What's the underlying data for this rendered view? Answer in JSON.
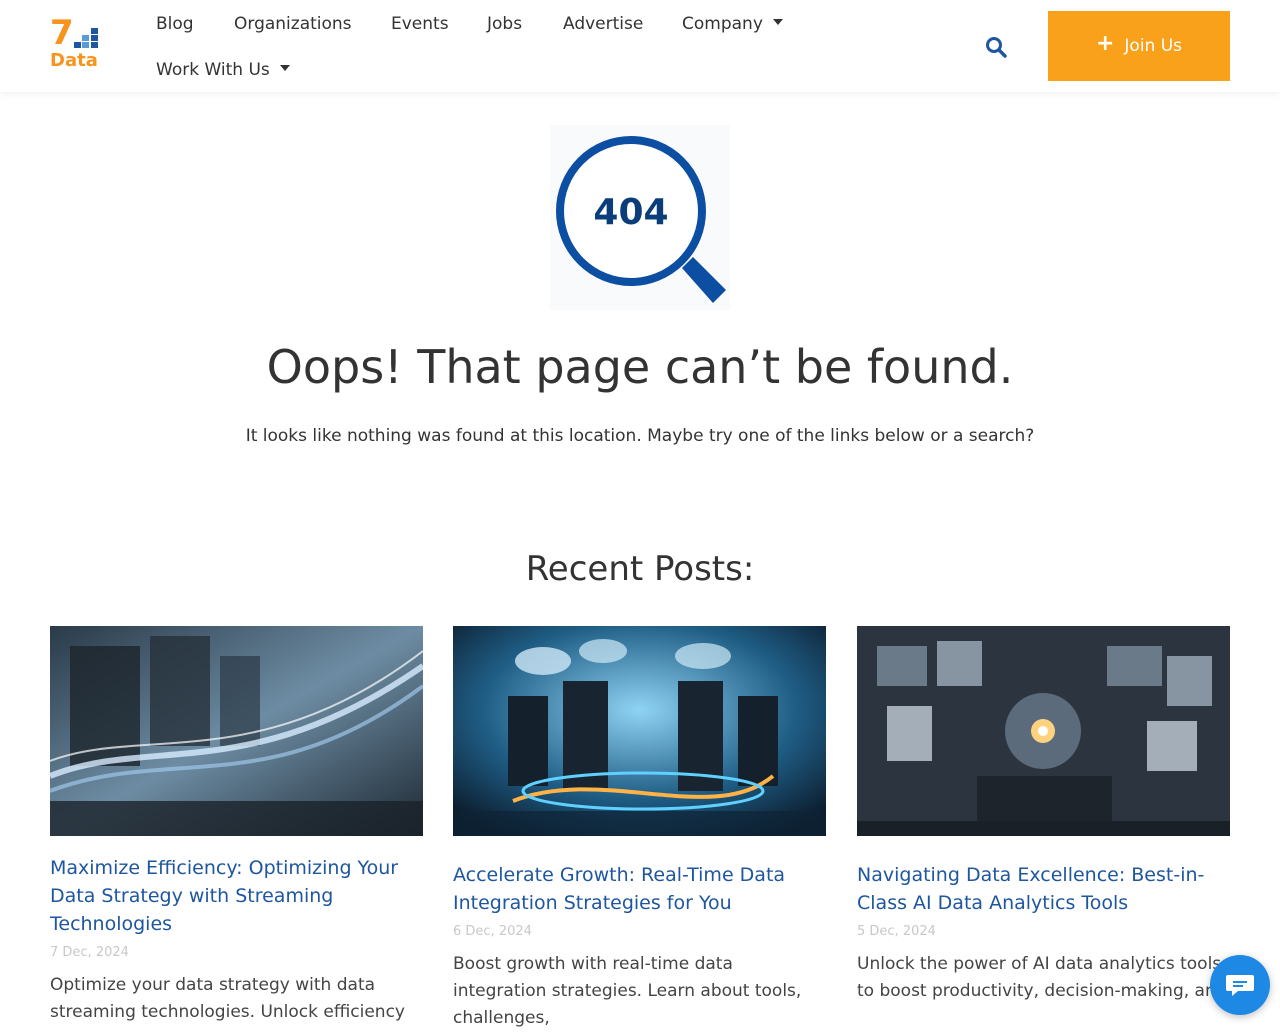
{
  "brand": {
    "logo_number": "7",
    "logo_word": "Data",
    "accent_color": "#f9a11b",
    "link_color": "#1e56a0"
  },
  "nav": {
    "items": [
      {
        "label": "Blog"
      },
      {
        "label": "Organizations"
      },
      {
        "label": "Events"
      },
      {
        "label": "Jobs"
      },
      {
        "label": "Advertise"
      },
      {
        "label": "Company",
        "has_dropdown": true
      },
      {
        "label": "Work With Us",
        "has_dropdown": true
      }
    ],
    "search_icon": "search-icon",
    "join_label": "Join Us"
  },
  "error": {
    "code": "404",
    "title": "Oops! That page can’t be found.",
    "message": "It looks like nothing was found at this location. Maybe try one of the links below or a search?"
  },
  "recent": {
    "heading": "Recent Posts:",
    "posts": [
      {
        "title": "Maximize Efficiency: Optimizing Your Data Strategy with Streaming Technologies",
        "date": "7 Dec, 2024",
        "excerpt": "Optimize your data strategy with data streaming technologies. Unlock efficiency"
      },
      {
        "title": "Accelerate Growth: Real-Time Data Integration Strategies for You",
        "date": "6 Dec, 2024",
        "excerpt": "Boost growth with real-time data integration strategies. Learn about tools, challenges,"
      },
      {
        "title": "Navigating Data Excellence: Best-in-Class AI Data Analytics Tools",
        "date": "5 Dec, 2024",
        "excerpt": "Unlock the power of AI data analytics tools to boost productivity, decision-making, and"
      }
    ]
  },
  "chat": {
    "icon": "chat-icon"
  }
}
